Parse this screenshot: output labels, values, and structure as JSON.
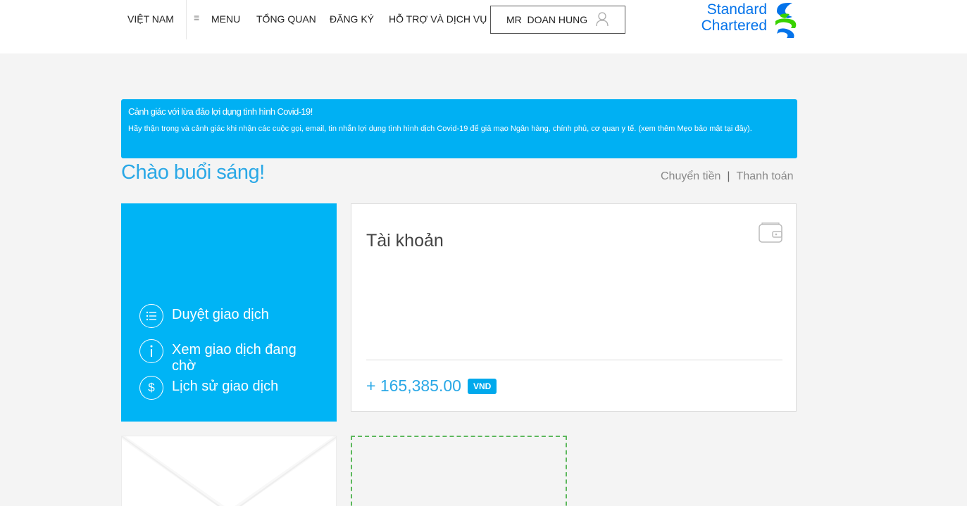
{
  "header": {
    "country": "VIỆT NAM",
    "menu_label": "MENU",
    "nav": [
      "TỔNG QUAN",
      "ĐĂNG KÝ",
      "HỖ TRỢ VÀ DỊCH VỤ"
    ],
    "user_name": "MR  DOAN HUNG",
    "logo_line1": "Standard",
    "logo_line2": "Chartered",
    "brand_colors": {
      "blue": "#0473ea",
      "green": "#38d200"
    }
  },
  "alert": {
    "title": "Cảnh giác với lừa đảo lợi dụng tình hình Covid-19!",
    "body": "Hãy thận trọng và cảnh giác khi nhận các cuộc gọi, email, tin nhắn lợi dụng tình hình dịch Covid-19 để giả mạo Ngân hàng, chính phủ, cơ quan y tế. (xem thêm Mẹo bảo mật tại đây).",
    "color": "#00b0f3"
  },
  "greeting": "Chào buổi sáng!",
  "quick_links": {
    "transfer": "Chuyển tiền",
    "separator": "|",
    "payment": "Thanh toán"
  },
  "panel": {
    "items": [
      {
        "label": "Duyệt giao dịch",
        "icon": "list-icon"
      },
      {
        "label": "Xem giao dịch đang chờ",
        "icon": "info-icon"
      },
      {
        "label": "Lịch sử giao dịch",
        "icon": "dollar-icon"
      }
    ]
  },
  "account": {
    "title": "Tài khoản",
    "icon": "wallet-icon",
    "balance": "+ 165,385.00",
    "currency": "VND"
  }
}
